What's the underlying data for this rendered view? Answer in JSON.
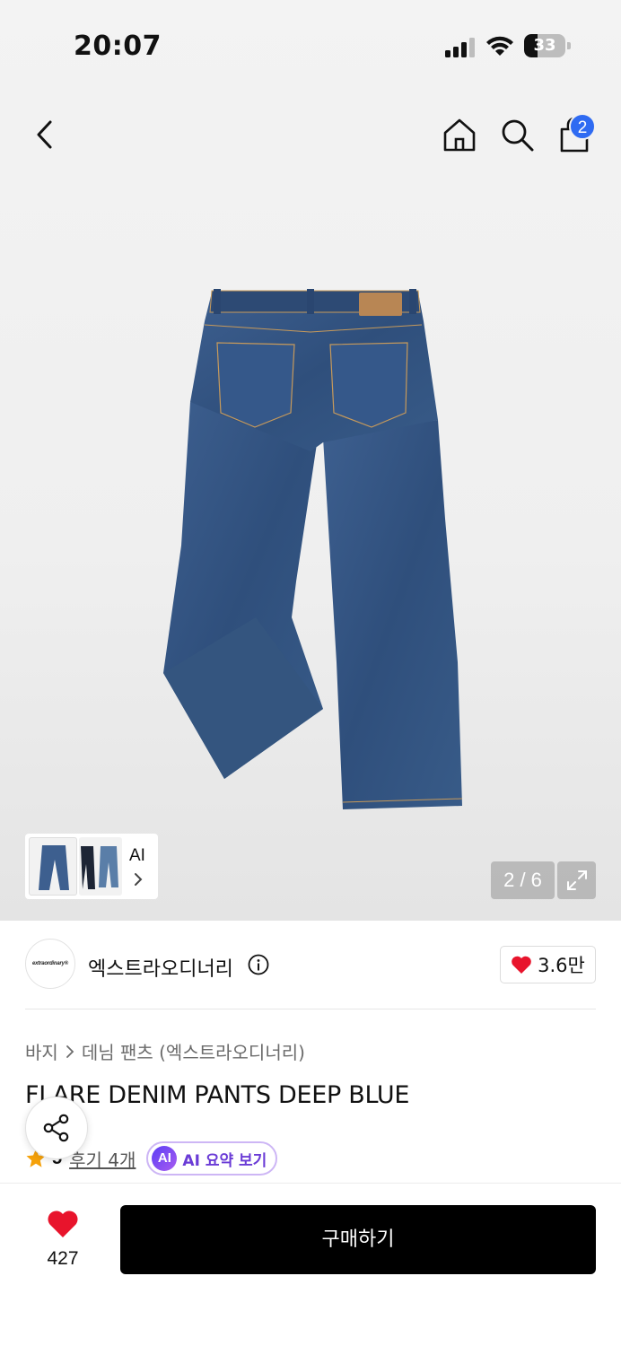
{
  "status_bar": {
    "time": "20:07",
    "battery": "33",
    "battery_level": 0.33
  },
  "header": {
    "cart_count": "2"
  },
  "gallery": {
    "ai_label": "AI",
    "page_counter": "2 / 6"
  },
  "brand": {
    "logo_text": "extraordinary®",
    "name": "엑스트라오디너리",
    "likes": "3.6만"
  },
  "product": {
    "breadcrumb": [
      "바지",
      "데님 팬츠 (엑스트라오디너리)"
    ],
    "title": "FLARE DENIM PANTS DEEP BLUE",
    "rating": "5",
    "review_link": "후기 4개",
    "ai_badge": "AI",
    "ai_summary": "AI 요약 보기"
  },
  "bottom_bar": {
    "wish_count": "427",
    "buy_label": "구매하기"
  },
  "colors": {
    "accent_blue": "#2f6bf2",
    "heart_red": "#e8142c",
    "star_orange": "#f5a10a",
    "ai_purple": "#6a3bd6"
  }
}
